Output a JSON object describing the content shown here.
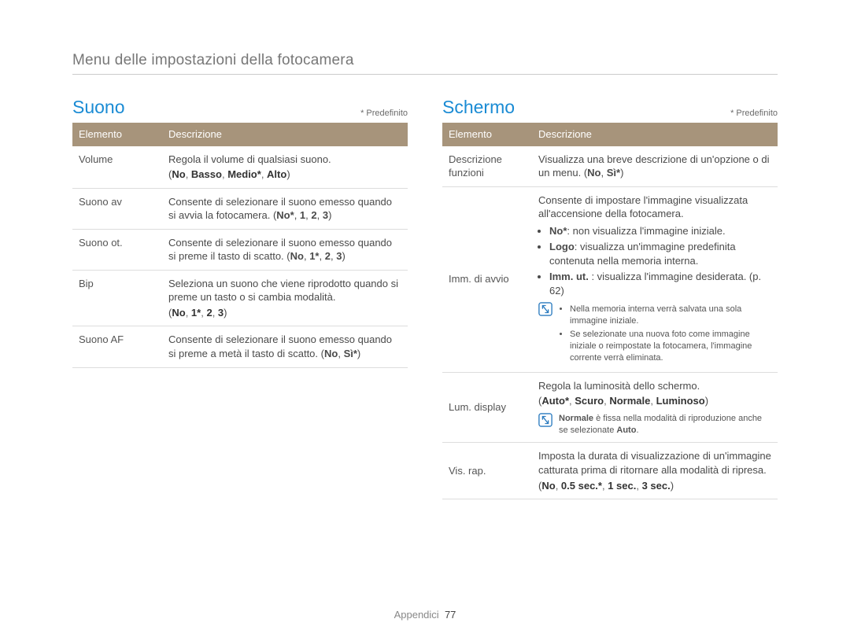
{
  "page_title": "Menu delle impostazioni della fotocamera",
  "default_label": "* Predefinito",
  "headers": {
    "element": "Elemento",
    "description": "Descrizione"
  },
  "suono": {
    "title": "Suono",
    "rows": [
      {
        "elem": "Volume",
        "desc": "Regola il volume di qualsiasi suono.",
        "opts": [
          {
            "t": "No",
            "b": true
          },
          {
            "t": ", "
          },
          {
            "t": "Basso",
            "b": true
          },
          {
            "t": ", "
          },
          {
            "t": "Medio*",
            "b": true
          },
          {
            "t": ", "
          },
          {
            "t": "Alto",
            "b": true
          }
        ]
      },
      {
        "elem": "Suono av",
        "desc": "Consente di selezionare il suono emesso quando si avvia la fotocamera. ",
        "opts_inline": [
          {
            "t": "No*",
            "b": true
          },
          {
            "t": ", "
          },
          {
            "t": "1",
            "b": true
          },
          {
            "t": ", "
          },
          {
            "t": "2",
            "b": true
          },
          {
            "t": ", "
          },
          {
            "t": "3",
            "b": true
          }
        ]
      },
      {
        "elem": "Suono ot.",
        "desc": "Consente di selezionare il suono emesso quando si preme il tasto di scatto. ",
        "opts_inline": [
          {
            "t": "No",
            "b": true
          },
          {
            "t": ", "
          },
          {
            "t": "1*",
            "b": true
          },
          {
            "t": ", "
          },
          {
            "t": "2",
            "b": true
          },
          {
            "t": ", "
          },
          {
            "t": "3",
            "b": true
          }
        ]
      },
      {
        "elem": "Bip",
        "desc": "Seleziona un suono che viene riprodotto quando si preme un tasto o si cambia modalità.",
        "opts": [
          {
            "t": "No",
            "b": true
          },
          {
            "t": ", "
          },
          {
            "t": "1*",
            "b": true
          },
          {
            "t": ", "
          },
          {
            "t": "2",
            "b": true
          },
          {
            "t": ", "
          },
          {
            "t": "3",
            "b": true
          }
        ]
      },
      {
        "elem": "Suono AF",
        "desc": "Consente di selezionare il suono emesso quando si preme a metà il tasto di scatto. ",
        "opts_inline": [
          {
            "t": "No",
            "b": true
          },
          {
            "t": ", "
          },
          {
            "t": "Sì*",
            "b": true
          }
        ]
      }
    ]
  },
  "schermo": {
    "title": "Schermo",
    "rows": {
      "descfunz": {
        "elem": "Descrizione funzioni",
        "desc": "Visualizza una breve descrizione di un'opzione o di un menu. ",
        "opts_inline": [
          {
            "t": "No",
            "b": true
          },
          {
            "t": ", "
          },
          {
            "t": "Sì*",
            "b": true
          }
        ]
      },
      "immavvio": {
        "elem": "Imm. di avvio",
        "intro": "Consente di impostare l'immagine visualizzata all'accensione della fotocamera.",
        "bullets": [
          {
            "pre": "No*",
            "text": ": non visualizza l'immagine iniziale."
          },
          {
            "pre": "Logo",
            "text": ": visualizza un'immagine predefinita contenuta nella memoria interna."
          },
          {
            "pre": "Imm. ut.",
            "text": " : visualizza l'immagine desiderata. (p. 62)"
          }
        ],
        "notes": [
          "Nella memoria interna verrà salvata una sola immagine iniziale.",
          "Se selezionate una nuova foto come immagine iniziale o reimpostate la fotocamera, l'immagine corrente verrà eliminata."
        ]
      },
      "lum": {
        "elem": "Lum. display",
        "desc": "Regola la luminosità dello schermo.",
        "opts": [
          {
            "t": "Auto*",
            "b": true
          },
          {
            "t": ", "
          },
          {
            "t": "Scuro",
            "b": true
          },
          {
            "t": ", "
          },
          {
            "t": "Normale",
            "b": true
          },
          {
            "t": ", "
          },
          {
            "t": "Luminoso",
            "b": true
          }
        ],
        "note_bold": "Normale",
        "note_rest": " è fissa nella modalità di riproduzione anche se selezionate ",
        "note_bold2": "Auto",
        "note_tail": "."
      },
      "visrap": {
        "elem": "Vis. rap.",
        "desc": "Imposta la durata di visualizzazione di un'immagine catturata prima di ritornare alla modalità di ripresa.",
        "opts": [
          {
            "t": "No",
            "b": true
          },
          {
            "t": ", "
          },
          {
            "t": "0.5 sec.*",
            "b": true
          },
          {
            "t": ", "
          },
          {
            "t": "1 sec.",
            "b": true
          },
          {
            "t": ", "
          },
          {
            "t": "3 sec.",
            "b": true
          }
        ]
      }
    }
  },
  "footer": {
    "section": "Appendici",
    "page": "77"
  },
  "chart_data": {
    "type": "table"
  }
}
